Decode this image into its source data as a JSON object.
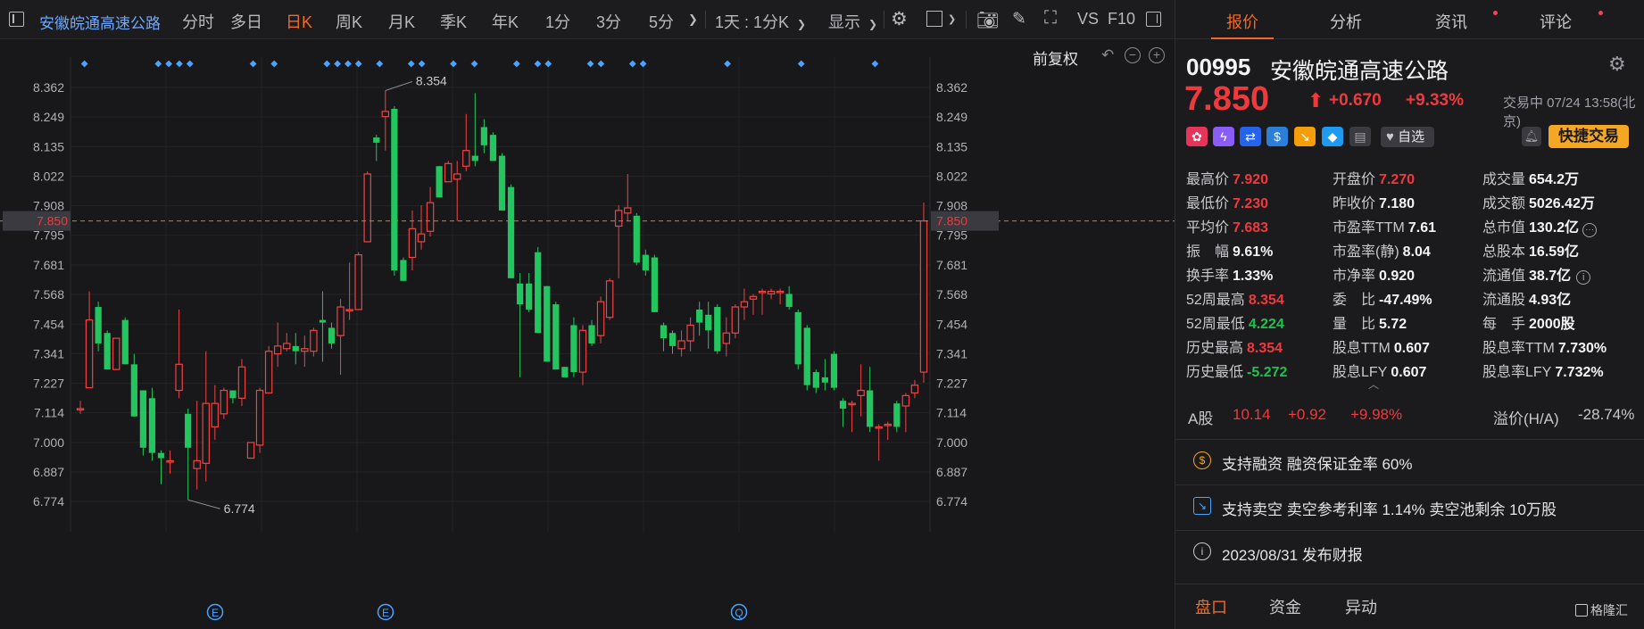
{
  "toolbar": {
    "stock_name": "安徽皖通高速公路",
    "periods": [
      "分时",
      "多日",
      "日K",
      "周K",
      "月K",
      "季K",
      "年K",
      "1分",
      "3分",
      "5分"
    ],
    "active_period": "日K",
    "interval": "1天 : 1分K",
    "display": "显示",
    "vs": "VS",
    "f10": "F10"
  },
  "chart": {
    "fuquan": "前复权",
    "current_price_label": "7.850",
    "high_marker": "8.354",
    "low_marker": "6.774",
    "event_markers": [
      "E",
      "E",
      "Q"
    ],
    "up_color": "#ef4444",
    "down_color": "#22c55e",
    "accent": "#f26a23",
    "dividend_marker_color": "#4aa3ff"
  },
  "chart_data": {
    "type": "candlestick",
    "y_ticks": [
      "8.362",
      "8.249",
      "8.135",
      "8.022",
      "7.908",
      "7.795",
      "7.681",
      "7.568",
      "7.454",
      "7.341",
      "7.227",
      "7.114",
      "7.000",
      "6.887",
      "6.774"
    ],
    "ylim": [
      6.774,
      8.362
    ],
    "candles": [
      {
        "o": 7.13,
        "h": 7.16,
        "l": 7.11,
        "c": 7.13
      },
      {
        "o": 7.21,
        "h": 7.58,
        "l": 7.21,
        "c": 7.47
      },
      {
        "o": 7.52,
        "h": 7.54,
        "l": 7.35,
        "c": 7.38
      },
      {
        "o": 7.42,
        "h": 7.43,
        "l": 7.28,
        "c": 7.28
      },
      {
        "o": 7.28,
        "h": 7.4,
        "l": 7.28,
        "c": 7.4
      },
      {
        "o": 7.47,
        "h": 7.48,
        "l": 7.3,
        "c": 7.3
      },
      {
        "o": 7.3,
        "h": 7.34,
        "l": 7.1,
        "c": 7.1
      },
      {
        "o": 7.2,
        "h": 7.2,
        "l": 6.95,
        "c": 6.98
      },
      {
        "o": 7.17,
        "h": 7.21,
        "l": 6.93,
        "c": 6.96
      },
      {
        "o": 6.96,
        "h": 6.97,
        "l": 6.84,
        "c": 6.94
      },
      {
        "o": 6.93,
        "h": 6.97,
        "l": 6.88,
        "c": 6.93
      },
      {
        "o": 7.2,
        "h": 7.51,
        "l": 7.17,
        "c": 7.3
      },
      {
        "o": 7.11,
        "h": 7.13,
        "l": 6.78,
        "c": 6.98
      },
      {
        "o": 6.9,
        "h": 7.16,
        "l": 6.82,
        "c": 6.93
      },
      {
        "o": 6.92,
        "h": 7.35,
        "l": 6.85,
        "c": 7.15
      },
      {
        "o": 7.06,
        "h": 7.22,
        "l": 7.01,
        "c": 7.15
      },
      {
        "o": 7.11,
        "h": 7.21,
        "l": 7.09,
        "c": 7.2
      },
      {
        "o": 7.2,
        "h": 7.2,
        "l": 7.15,
        "c": 7.17
      },
      {
        "o": 7.17,
        "h": 7.32,
        "l": 7.14,
        "c": 7.29
      },
      {
        "o": 6.94,
        "h": 7.0,
        "l": 6.94,
        "c": 7.0
      },
      {
        "o": 6.99,
        "h": 7.21,
        "l": 6.96,
        "c": 7.2
      },
      {
        "o": 7.19,
        "h": 7.37,
        "l": 7.19,
        "c": 7.35
      },
      {
        "o": 7.34,
        "h": 7.46,
        "l": 7.29,
        "c": 7.37
      },
      {
        "o": 7.36,
        "h": 7.42,
        "l": 7.35,
        "c": 7.38
      },
      {
        "o": 7.37,
        "h": 7.42,
        "l": 7.3,
        "c": 7.35
      },
      {
        "o": 7.35,
        "h": 7.41,
        "l": 7.29,
        "c": 7.36
      },
      {
        "o": 7.35,
        "h": 7.44,
        "l": 7.33,
        "c": 7.43
      },
      {
        "o": 7.47,
        "h": 7.58,
        "l": 7.31,
        "c": 7.46
      },
      {
        "o": 7.44,
        "h": 7.46,
        "l": 7.36,
        "c": 7.38
      },
      {
        "o": 7.41,
        "h": 7.55,
        "l": 7.26,
        "c": 7.52
      },
      {
        "o": 7.51,
        "h": 7.69,
        "l": 7.47,
        "c": 7.51
      },
      {
        "o": 7.51,
        "h": 7.73,
        "l": 7.51,
        "c": 7.72
      },
      {
        "o": 7.77,
        "h": 8.04,
        "l": 7.77,
        "c": 8.03
      },
      {
        "o": 8.17,
        "h": 8.18,
        "l": 8.08,
        "c": 8.15
      },
      {
        "o": 8.25,
        "h": 8.35,
        "l": 8.12,
        "c": 8.27
      },
      {
        "o": 8.28,
        "h": 8.29,
        "l": 7.64,
        "c": 7.66
      },
      {
        "o": 7.7,
        "h": 7.71,
        "l": 7.62,
        "c": 7.62
      },
      {
        "o": 7.71,
        "h": 7.89,
        "l": 7.66,
        "c": 7.82
      },
      {
        "o": 7.77,
        "h": 7.91,
        "l": 7.74,
        "c": 7.8
      },
      {
        "o": 7.81,
        "h": 7.98,
        "l": 7.79,
        "c": 7.92
      },
      {
        "o": 8.06,
        "h": 8.06,
        "l": 7.94,
        "c": 7.94
      },
      {
        "o": 8.0,
        "h": 8.08,
        "l": 8.0,
        "c": 8.07
      },
      {
        "o": 8.01,
        "h": 8.08,
        "l": 7.85,
        "c": 8.03
      },
      {
        "o": 8.06,
        "h": 8.26,
        "l": 8.04,
        "c": 8.12
      },
      {
        "o": 8.1,
        "h": 8.34,
        "l": 8.06,
        "c": 8.08
      },
      {
        "o": 8.21,
        "h": 8.24,
        "l": 8.11,
        "c": 8.14
      },
      {
        "o": 8.18,
        "h": 8.19,
        "l": 8.08,
        "c": 8.08
      },
      {
        "o": 8.1,
        "h": 8.11,
        "l": 7.89,
        "c": 7.89
      },
      {
        "o": 7.98,
        "h": 7.99,
        "l": 7.63,
        "c": 7.63
      },
      {
        "o": 7.61,
        "h": 7.65,
        "l": 7.25,
        "c": 7.53
      },
      {
        "o": 7.61,
        "h": 7.65,
        "l": 7.5,
        "c": 7.51
      },
      {
        "o": 7.73,
        "h": 7.75,
        "l": 7.42,
        "c": 7.42
      },
      {
        "o": 7.6,
        "h": 7.6,
        "l": 7.31,
        "c": 7.31
      },
      {
        "o": 7.53,
        "h": 7.54,
        "l": 7.28,
        "c": 7.28
      },
      {
        "o": 7.29,
        "h": 7.29,
        "l": 7.25,
        "c": 7.25
      },
      {
        "o": 7.45,
        "h": 7.48,
        "l": 7.25,
        "c": 7.27
      },
      {
        "o": 7.27,
        "h": 7.45,
        "l": 7.22,
        "c": 7.43
      },
      {
        "o": 7.45,
        "h": 7.47,
        "l": 7.37,
        "c": 7.38
      },
      {
        "o": 7.41,
        "h": 7.56,
        "l": 7.38,
        "c": 7.54
      },
      {
        "o": 7.48,
        "h": 7.63,
        "l": 7.47,
        "c": 7.62
      },
      {
        "o": 7.83,
        "h": 7.91,
        "l": 7.63,
        "c": 7.89
      },
      {
        "o": 7.88,
        "h": 8.03,
        "l": 7.85,
        "c": 7.9
      },
      {
        "o": 7.87,
        "h": 7.88,
        "l": 7.68,
        "c": 7.69
      },
      {
        "o": 7.72,
        "h": 7.74,
        "l": 7.64,
        "c": 7.66
      },
      {
        "o": 7.71,
        "h": 7.72,
        "l": 7.5,
        "c": 7.5
      },
      {
        "o": 7.45,
        "h": 7.46,
        "l": 7.35,
        "c": 7.4
      },
      {
        "o": 7.42,
        "h": 7.43,
        "l": 7.34,
        "c": 7.37
      },
      {
        "o": 7.36,
        "h": 7.43,
        "l": 7.33,
        "c": 7.39
      },
      {
        "o": 7.39,
        "h": 7.48,
        "l": 7.35,
        "c": 7.45
      },
      {
        "o": 7.51,
        "h": 7.54,
        "l": 7.41,
        "c": 7.46
      },
      {
        "o": 7.49,
        "h": 7.54,
        "l": 7.36,
        "c": 7.43
      },
      {
        "o": 7.52,
        "h": 7.53,
        "l": 7.34,
        "c": 7.35
      },
      {
        "o": 7.38,
        "h": 7.48,
        "l": 7.33,
        "c": 7.42
      },
      {
        "o": 7.42,
        "h": 7.53,
        "l": 7.4,
        "c": 7.52
      },
      {
        "o": 7.52,
        "h": 7.59,
        "l": 7.47,
        "c": 7.54
      },
      {
        "o": 7.55,
        "h": 7.57,
        "l": 7.49,
        "c": 7.56
      },
      {
        "o": 7.58,
        "h": 7.59,
        "l": 7.49,
        "c": 7.58
      },
      {
        "o": 7.57,
        "h": 7.59,
        "l": 7.55,
        "c": 7.58
      },
      {
        "o": 7.58,
        "h": 7.59,
        "l": 7.53,
        "c": 7.58
      },
      {
        "o": 7.57,
        "h": 7.6,
        "l": 7.51,
        "c": 7.52
      },
      {
        "o": 7.5,
        "h": 7.51,
        "l": 7.28,
        "c": 7.3
      },
      {
        "o": 7.44,
        "h": 7.45,
        "l": 7.2,
        "c": 7.22
      },
      {
        "o": 7.27,
        "h": 7.28,
        "l": 7.19,
        "c": 7.21
      },
      {
        "o": 7.25,
        "h": 7.32,
        "l": 7.2,
        "c": 7.23
      },
      {
        "o": 7.34,
        "h": 7.35,
        "l": 7.2,
        "c": 7.21
      },
      {
        "o": 7.16,
        "h": 7.17,
        "l": 7.06,
        "c": 7.13
      },
      {
        "o": 7.15,
        "h": 7.16,
        "l": 7.04,
        "c": 7.15
      },
      {
        "o": 7.18,
        "h": 7.3,
        "l": 7.1,
        "c": 7.2
      },
      {
        "o": 7.2,
        "h": 7.29,
        "l": 7.04,
        "c": 7.06
      },
      {
        "o": 7.06,
        "h": 7.07,
        "l": 6.93,
        "c": 7.06
      },
      {
        "o": 7.07,
        "h": 7.08,
        "l": 7.01,
        "c": 7.07
      },
      {
        "o": 7.15,
        "h": 7.16,
        "l": 7.04,
        "c": 7.06
      },
      {
        "o": 7.14,
        "h": 7.19,
        "l": 7.04,
        "c": 7.18
      },
      {
        "o": 7.19,
        "h": 7.24,
        "l": 7.17,
        "c": 7.22
      },
      {
        "o": 7.27,
        "h": 7.92,
        "l": 7.23,
        "c": 7.85
      }
    ],
    "dividend_marker_slots": [
      0,
      7,
      8,
      9,
      10,
      16,
      18,
      23,
      24,
      25,
      26,
      28,
      31,
      32,
      35,
      37,
      41,
      43,
      44,
      48,
      49,
      52,
      53,
      61,
      68,
      75
    ]
  },
  "quote": {
    "code": "00995",
    "name": "安徽皖通高速公路",
    "price": "7.850",
    "change": "+0.670",
    "change_pct": "+9.33%",
    "status": "交易中 07/24 13:58(北京)",
    "watch_label": "自选",
    "quick_trade": "快捷交易"
  },
  "tabs": {
    "items": [
      "报价",
      "分析",
      "资讯",
      "评论"
    ],
    "active": "报价"
  },
  "stats": [
    [
      {
        "label": "最高价",
        "value": "7.920",
        "tone": "up"
      },
      {
        "label": "开盘价",
        "value": "7.270",
        "tone": "up"
      },
      {
        "label": "成交量",
        "value": "654.2万",
        "tone": "neutral"
      }
    ],
    [
      {
        "label": "最低价",
        "value": "7.230",
        "tone": "up"
      },
      {
        "label": "昨收价",
        "value": "7.180",
        "tone": "neutral"
      },
      {
        "label": "成交额",
        "value": "5026.42万",
        "tone": "neutral"
      }
    ],
    [
      {
        "label": "平均价",
        "value": "7.683",
        "tone": "up"
      },
      {
        "label": "市盈率TTM",
        "value": "7.61",
        "tone": "neutral"
      },
      {
        "label": "总市值",
        "value": "130.2亿",
        "tone": "neutral"
      }
    ],
    [
      {
        "label": "振　幅",
        "value": "9.61%",
        "tone": "neutral"
      },
      {
        "label": "市盈率(静)",
        "value": "8.04",
        "tone": "neutral"
      },
      {
        "label": "总股本",
        "value": "16.59亿",
        "tone": "neutral"
      }
    ],
    [
      {
        "label": "换手率",
        "value": "1.33%",
        "tone": "neutral"
      },
      {
        "label": "市净率",
        "value": "0.920",
        "tone": "neutral"
      },
      {
        "label": "流通值",
        "value": "38.7亿",
        "tone": "neutral"
      }
    ],
    [
      {
        "label": "52周最高",
        "value": "8.354",
        "tone": "up"
      },
      {
        "label": "委　比",
        "value": "-47.49%",
        "tone": "neutral"
      },
      {
        "label": "流通股",
        "value": "4.93亿",
        "tone": "neutral"
      }
    ],
    [
      {
        "label": "52周最低",
        "value": "4.224",
        "tone": "down"
      },
      {
        "label": "量　比",
        "value": "5.72",
        "tone": "neutral"
      },
      {
        "label": "每　手",
        "value": "2000股",
        "tone": "neutral"
      }
    ],
    [
      {
        "label": "历史最高",
        "value": "8.354",
        "tone": "up"
      },
      {
        "label": "股息TTM",
        "value": "0.607",
        "tone": "neutral"
      },
      {
        "label": "股息率TTM",
        "value": "7.730%",
        "tone": "neutral"
      }
    ],
    [
      {
        "label": "历史最低",
        "value": "-5.272",
        "tone": "down"
      },
      {
        "label": "股息LFY",
        "value": "0.607",
        "tone": "neutral"
      },
      {
        "label": "股息率LFY",
        "value": "7.732%",
        "tone": "neutral"
      }
    ]
  ],
  "ashare": {
    "label": "A股",
    "price": "10.14",
    "change": "+0.92",
    "pct": "+9.98%",
    "premium_label": "溢价(H/A)",
    "premium": "-28.74%"
  },
  "info_items": [
    "支持融资 融资保证金率 60%",
    "支持卖空 卖空参考利率 1.14% 卖空池剩余 10万股",
    "2023/08/31  发布财报"
  ],
  "bottom_tabs": [
    "盘口",
    "资金",
    "异动"
  ],
  "watermark": "格隆汇"
}
